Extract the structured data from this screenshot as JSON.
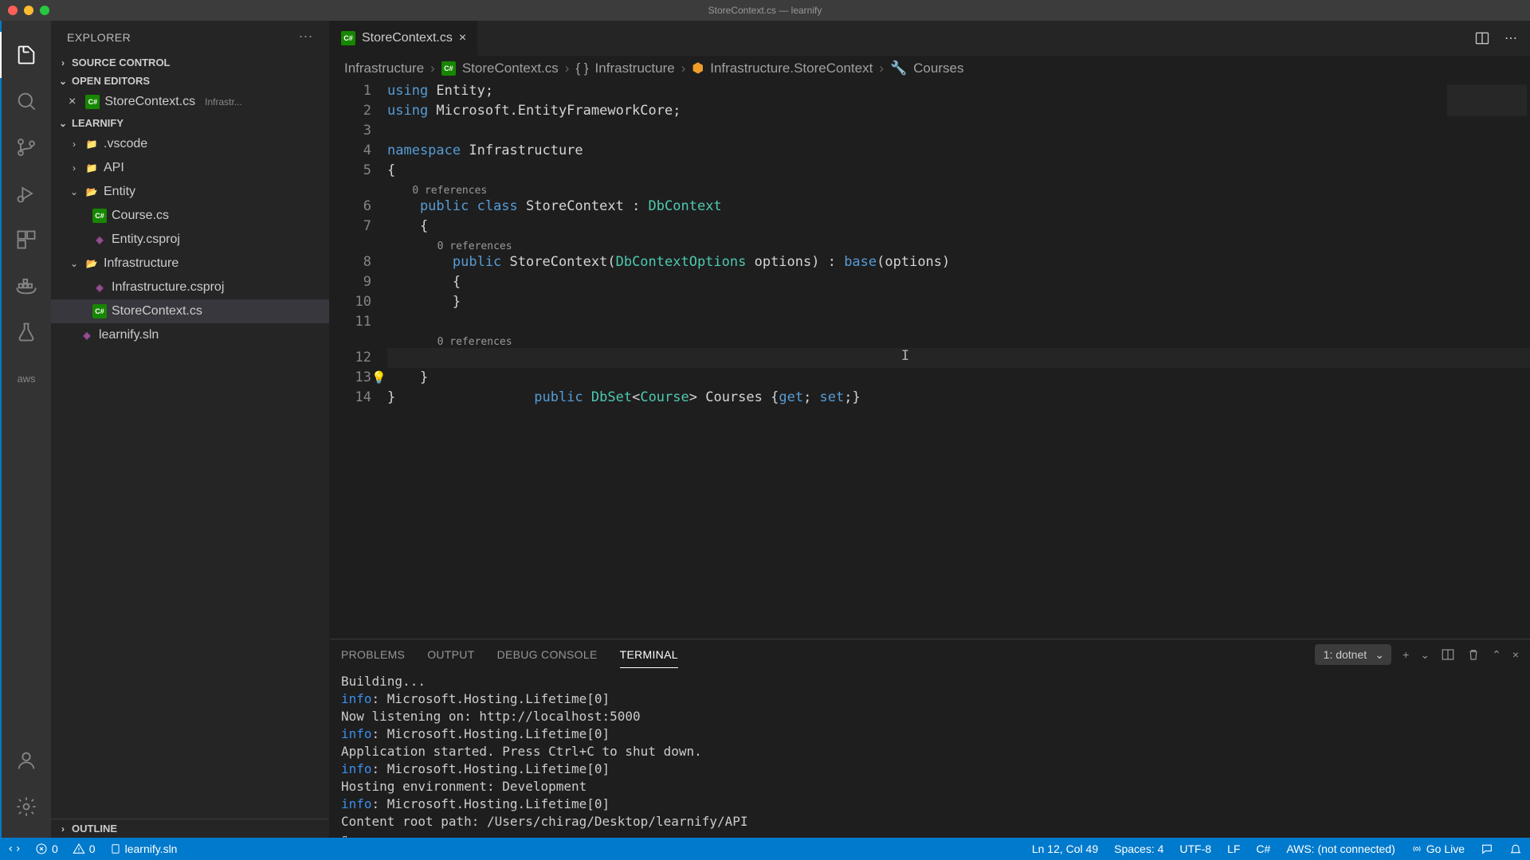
{
  "window": {
    "title": "StoreContext.cs — learnify"
  },
  "explorer": {
    "title": "EXPLORER",
    "sections": {
      "source_control": "SOURCE CONTROL",
      "open_editors": "OPEN EDITORS",
      "workspace": "LEARNIFY",
      "outline": "OUTLINE"
    },
    "open_editor": {
      "file": "StoreContext.cs",
      "hint": "Infrastr..."
    },
    "tree": {
      "vscode": ".vscode",
      "api": "API",
      "entity": "Entity",
      "course": "Course.cs",
      "entity_proj": "Entity.csproj",
      "infrastructure": "Infrastructure",
      "infra_proj": "Infrastructure.csproj",
      "store_ctx": "StoreContext.cs",
      "solution": "learnify.sln"
    }
  },
  "tab": {
    "file": "StoreContext.cs",
    "lang_badge": "C#"
  },
  "breadcrumb": {
    "p1": "Infrastructure",
    "p2": "StoreContext.cs",
    "p3": "Infrastructure",
    "p4": "Infrastructure.StoreContext",
    "p5": "Courses"
  },
  "code": {
    "refs": "0 references",
    "l1a": "using",
    "l1b": " Entity;",
    "l2a": "using",
    "l2b": " Microsoft.EntityFrameworkCore;",
    "l4a": "namespace",
    "l4b": " Infrastructure",
    "l5": "{",
    "l6a": "    public",
    "l6b": " class",
    "l6c": " StoreContext : ",
    "l6d": "DbContext",
    "l7": "    {",
    "l8a": "        public",
    "l8b": " StoreContext(",
    "l8c": "DbContextOptions",
    "l8d": " options) : ",
    "l8e": "base",
    "l8f": "(options)",
    "l9": "        {",
    "l10": "        }",
    "l12a": "        public",
    "l12b": " DbSet",
    "l12c": "<",
    "l12d": "Course",
    "l12e": "> Courses {",
    "l12f": "get",
    "l12g": "; ",
    "l12h": "set",
    "l12i": ";}",
    "l13": "    }",
    "l14": "}"
  },
  "panel": {
    "tabs": {
      "problems": "PROBLEMS",
      "output": "OUTPUT",
      "debug": "DEBUG CONSOLE",
      "terminal": "TERMINAL"
    },
    "terminal_select": "1: dotnet",
    "output": {
      "building": "Building...",
      "info": "info",
      "src": ": Microsoft.Hosting.Lifetime[0]",
      "l1": "      Now listening on: http://localhost:5000",
      "l2": "      Application started. Press Ctrl+C to shut down.",
      "l3": "      Hosting environment: Development",
      "l4": "      Content root path: /Users/chirag/Desktop/learnify/API",
      "cursor": "▯"
    }
  },
  "status": {
    "errors": "0",
    "warnings": "0",
    "solution": "learnify.sln",
    "pos": "Ln 12, Col 49",
    "spaces": "Spaces: 4",
    "encoding": "UTF-8",
    "eol": "LF",
    "lang": "C#",
    "aws": "AWS: (not connected)",
    "golive": "Go Live"
  }
}
